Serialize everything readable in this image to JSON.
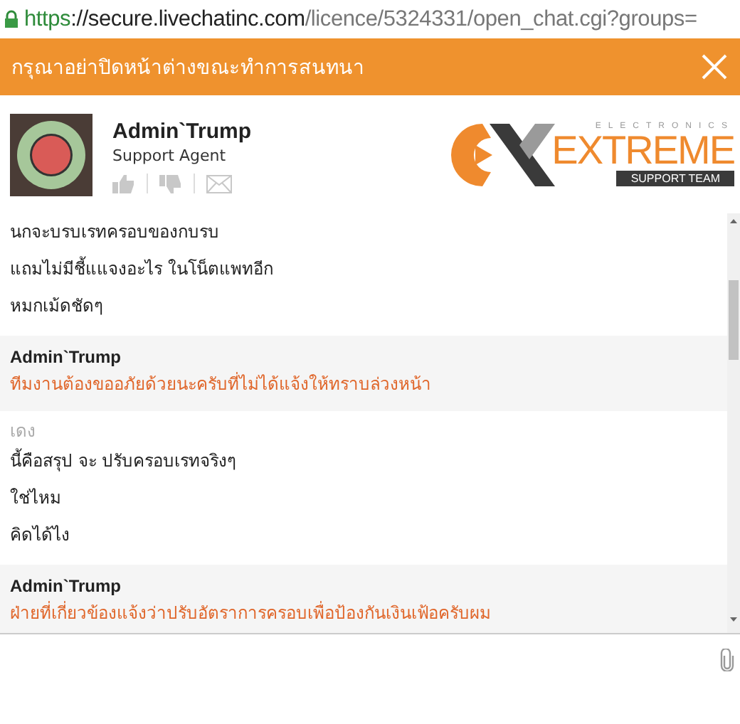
{
  "address_bar": {
    "scheme": "https",
    "host": "://secure.livechatinc.com",
    "path": "/licence/5324331/open_chat.cgi?groups="
  },
  "header": {
    "title": "กรุณาอย่าปิดหน้าต่างขณะทำการสนทนา"
  },
  "agent": {
    "name": "Admin`Trump",
    "role": "Support Agent"
  },
  "logo": {
    "top": "ELECTRONICS",
    "main": "EXTREME",
    "band": "SUPPORT TEAM"
  },
  "messages": [
    {
      "kind": "visitor",
      "lines": [
        "นกจะบรบเรทครอบของกบรบ",
        "แถมไม่มีชี้แแจงอะไร ในโน็ตแพทอีก",
        "หมกเม้ดชัดๆ"
      ]
    },
    {
      "kind": "agent",
      "author": "Admin`Trump",
      "lines": [
        "ทีมงานต้องขออภัยด้วยนะครับที่ไม่ได้แจ้งให้ทราบล่วงหน้า"
      ]
    },
    {
      "kind": "visitor",
      "author": "เดง",
      "lines": [
        "นี้คือสรุป จะ ปรับครอบเรทจริงๆ",
        "ใช่ไหม",
        "คิดได้ไง"
      ]
    },
    {
      "kind": "agent",
      "author": "Admin`Trump",
      "lines": [
        "ฝ่ายที่เกี่ยวข้องแจ้งว่าปรับอัตราการครอบเพื่อป้องกันเงินเฟ้อครับผม"
      ]
    }
  ]
}
